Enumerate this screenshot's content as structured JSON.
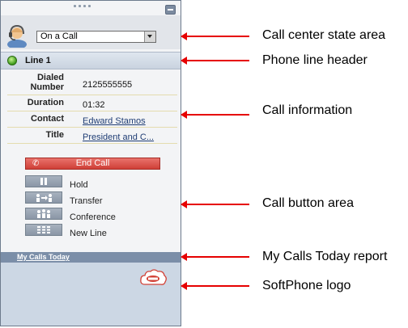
{
  "call_center_state": {
    "selected": "On a Call"
  },
  "phone_line": {
    "label": "Line 1",
    "status_color": "#3d9a1b"
  },
  "call_info": [
    {
      "label": "Dialed Number",
      "value": "2125555555",
      "link": false
    },
    {
      "label": "Duration",
      "value": "01:32",
      "link": false
    },
    {
      "label": "Contact",
      "value": "Edward Stamos",
      "link": true
    },
    {
      "label": "Title",
      "value": "President and C...",
      "link": true
    }
  ],
  "call_buttons": {
    "end_call": "End Call",
    "hold": "Hold",
    "transfer": "Transfer",
    "conference": "Conference",
    "new_line": "New Line"
  },
  "report": {
    "link_label": "My Calls Today"
  },
  "logo": {
    "icon": "salesforce-cloud-icon"
  },
  "annotations": {
    "color": "#e60000",
    "items": [
      "Call center state area",
      "Phone line header",
      "Call information",
      "Call button area",
      "My Calls Today report",
      "SoftPhone logo"
    ]
  }
}
